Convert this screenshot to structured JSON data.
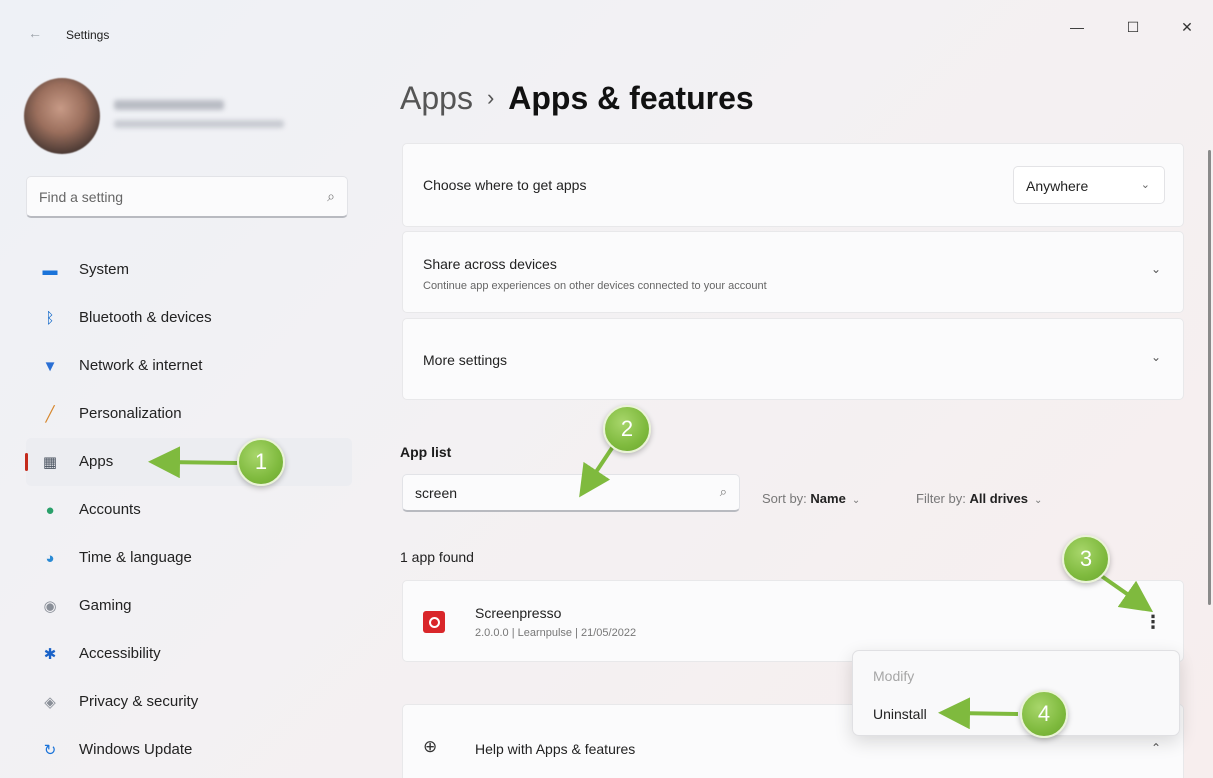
{
  "window": {
    "title": "Settings",
    "back_glyph": "←",
    "minimize_glyph": "—",
    "maximize_glyph": "☐",
    "close_glyph": "✕"
  },
  "sidebar": {
    "search_placeholder": "Find a setting",
    "search_icon": "⌕",
    "items": [
      {
        "label": "System",
        "icon": "system-icon",
        "glyph": "▬",
        "color": "#1a73d9"
      },
      {
        "label": "Bluetooth & devices",
        "icon": "bluetooth-icon",
        "glyph": "ᛒ",
        "color": "#0a64c8"
      },
      {
        "label": "Network & internet",
        "icon": "wifi-icon",
        "glyph": "▼",
        "color": "#2a6fd4"
      },
      {
        "label": "Personalization",
        "icon": "brush-icon",
        "glyph": "╱",
        "color": "#d6862a"
      },
      {
        "label": "Apps",
        "icon": "apps-icon",
        "glyph": "▦",
        "color": "#4a5360",
        "active": true
      },
      {
        "label": "Accounts",
        "icon": "accounts-icon",
        "glyph": "●",
        "color": "#2aa06a"
      },
      {
        "label": "Time & language",
        "icon": "globe-clock-icon",
        "glyph": "◕",
        "color": "#2a8ad4"
      },
      {
        "label": "Gaming",
        "icon": "gamepad-icon",
        "glyph": "◉",
        "color": "#8a8f98"
      },
      {
        "label": "Accessibility",
        "icon": "accessibility-icon",
        "glyph": "✱",
        "color": "#1a62c8"
      },
      {
        "label": "Privacy & security",
        "icon": "shield-icon",
        "glyph": "◈",
        "color": "#8a8f98"
      },
      {
        "label": "Windows Update",
        "icon": "update-icon",
        "glyph": "↻",
        "color": "#1a73d9"
      }
    ]
  },
  "breadcrumb": {
    "parent": "Apps",
    "separator": "›",
    "current": "Apps & features"
  },
  "cards": {
    "where": {
      "title": "Choose where to get apps",
      "dropdown_value": "Anywhere",
      "chevron": "⌄"
    },
    "share": {
      "title": "Share across devices",
      "subtitle": "Continue app experiences on other devices connected to your account",
      "chevron": "⌄"
    },
    "more": {
      "title": "More settings",
      "chevron": "⌄"
    }
  },
  "app_list": {
    "title": "App list",
    "search_value": "screen",
    "search_icon": "⌕",
    "sort_label": "Sort by:",
    "sort_value": "Name",
    "filter_label": "Filter by:",
    "filter_value": "All drives",
    "chevron": "⌄",
    "found_text": "1 app found",
    "apps": [
      {
        "name": "Screenpresso",
        "meta": "2.0.0.0  |  Learnpulse  |  21/05/2022"
      }
    ],
    "more_glyph": "⋮"
  },
  "context_menu": {
    "items": [
      {
        "label": "Modify",
        "disabled": true
      },
      {
        "label": "Uninstall",
        "disabled": false
      }
    ]
  },
  "help": {
    "label": "Help with Apps & features",
    "icon_glyph": "⊕",
    "chevron": "⌃"
  },
  "callouts": [
    "1",
    "2",
    "3",
    "4"
  ],
  "colors": {
    "callout_green": "#7fba3e",
    "active_bar": "#c42b1c",
    "app_icon_red": "#d9262a"
  }
}
